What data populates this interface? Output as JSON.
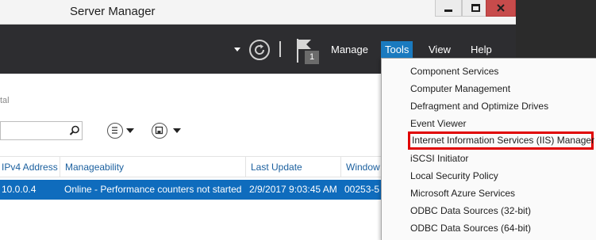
{
  "window": {
    "title": "Server Manager",
    "controls": [
      "minimize",
      "maximize",
      "close"
    ]
  },
  "header": {
    "manage": "Manage",
    "tools": "Tools",
    "view": "View",
    "help": "Help",
    "notification_count": "1",
    "tools_active_color": "#1a7abf"
  },
  "body": {
    "subtab_partial": "tal"
  },
  "table": {
    "columns": [
      "IPv4 Address",
      "Manageability",
      "Last Update",
      "Window"
    ],
    "rows": [
      [
        "10.0.0.4",
        "Online - Performance counters not started",
        "2/9/2017 9:03:45 AM",
        "00253-5"
      ]
    ],
    "selected_row_color": "#0f6cbd"
  },
  "tools_menu": {
    "items": [
      "Component Services",
      "Computer Management",
      "Defragment and Optimize Drives",
      "Event Viewer",
      "Internet Information Services (IIS) Manager",
      "iSCSI Initiator",
      "Local Security Policy",
      "Microsoft Azure Services",
      "ODBC Data Sources (32-bit)",
      "ODBC Data Sources (64-bit)"
    ],
    "highlighted_index": 4,
    "highlight_color": "#e00000"
  }
}
